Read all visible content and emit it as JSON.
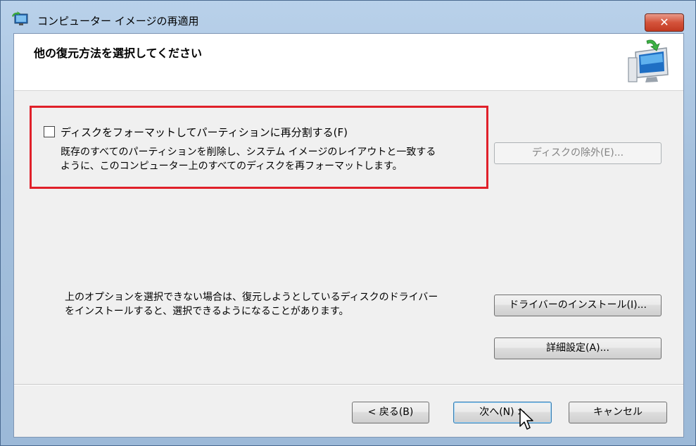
{
  "window": {
    "title": "コンピューター イメージの再適用",
    "close_glyph": "✕"
  },
  "header": {
    "heading": "他の復元方法を選択してください",
    "icon": "monitor-restore-icon"
  },
  "format_option": {
    "checked": false,
    "label": "ディスクをフォーマットしてパーティションに再分割する(F)",
    "description_lines": [
      "既存のすべてのパーティションを削除し、システム イメージのレイアウトと一致する",
      "ように、このコンピューター上のすべてのディスクを再フォーマットします。"
    ],
    "highlight_color": "#e0202a"
  },
  "buttons": {
    "exclude_disks": "ディスクの除外(E)...",
    "install_drivers": "ドライバーのインストール(I)...",
    "advanced": "詳細設定(A)...",
    "back": "< 戻る(B)",
    "next": "次へ(N) >",
    "cancel": "キャンセル"
  },
  "note_lines": [
    "上のオプションを選択できない場合は、復元しようとしているディスクのドライバー",
    "をインストールすると、選択できるようになることがあります。"
  ]
}
